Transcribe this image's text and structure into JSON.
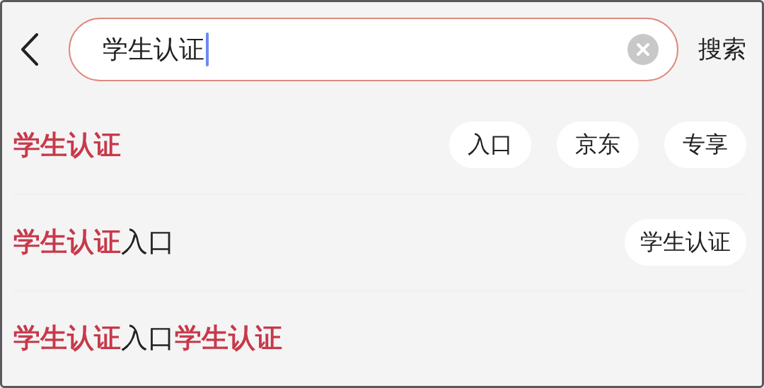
{
  "search": {
    "value": "学生认证",
    "button": "搜索"
  },
  "suggestions": [
    {
      "segments": [
        {
          "text": "学生认证",
          "highlight": true
        }
      ],
      "tags": [
        "入口",
        "京东",
        "专享"
      ]
    },
    {
      "segments": [
        {
          "text": "学生认证",
          "highlight": true
        },
        {
          "text": "入口",
          "highlight": false
        }
      ],
      "tags": [
        "学生认证"
      ]
    },
    {
      "segments": [
        {
          "text": "学生认证",
          "highlight": true
        },
        {
          "text": "入口",
          "highlight": false
        },
        {
          "text": "学生认证",
          "highlight": true
        }
      ]
    }
  ]
}
